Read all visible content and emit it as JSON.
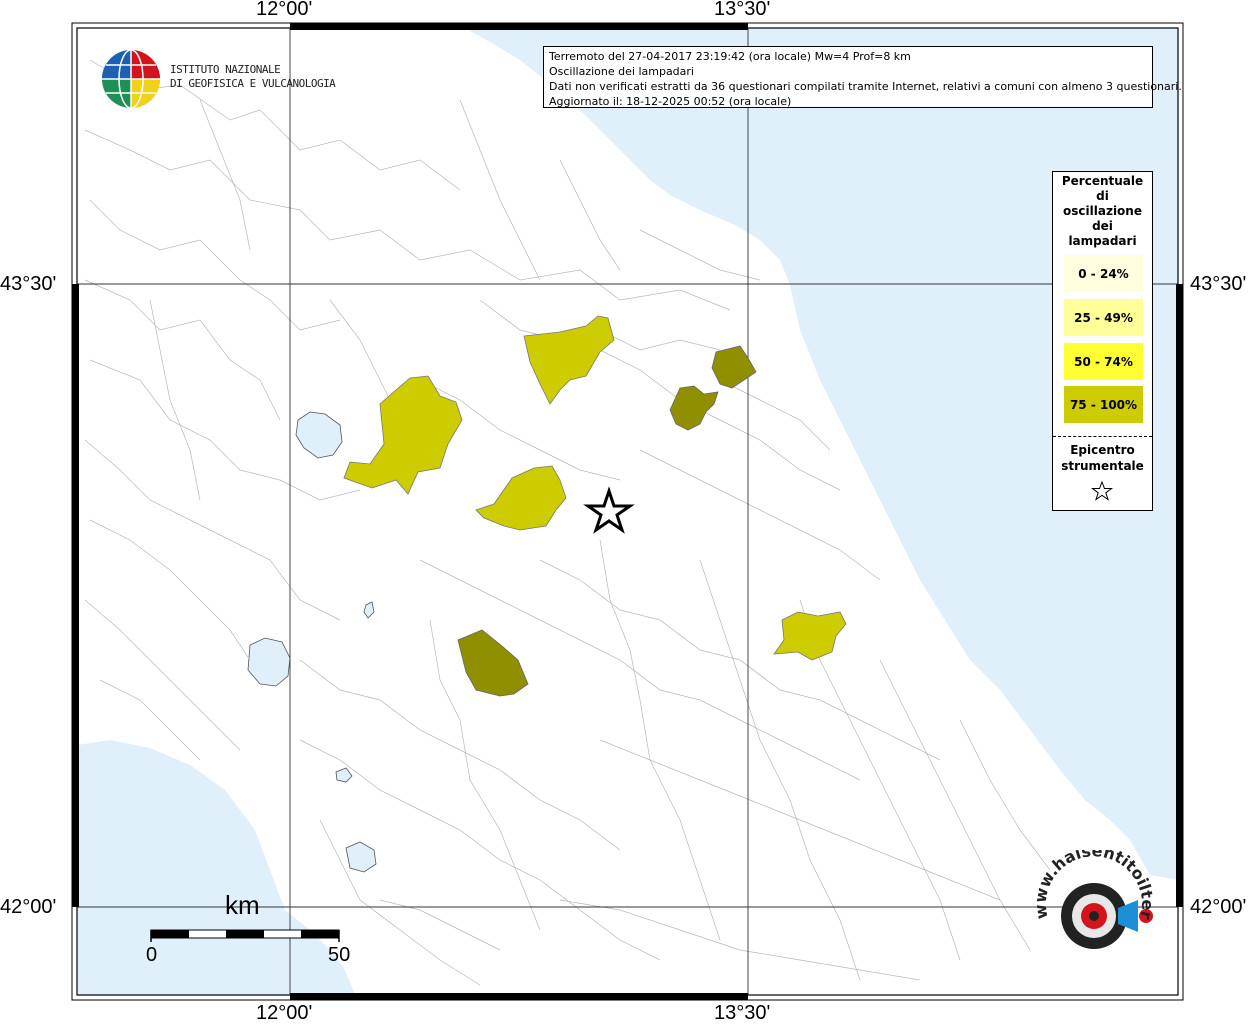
{
  "info": {
    "line1": "Terremoto del 27-04-2017 23:19:42 (ora locale) Mw=4 Prof=8 km",
    "line2": "Oscillazione dei lampadari",
    "line3": "Dati non verificati estratti da 36 questionari compilati tramite Internet, relativi a comuni con almeno 3 questionari.",
    "line4": "Aggiornato il: 18-12-2025 00:52 (ora locale)"
  },
  "axes": {
    "top_left": "12°00'",
    "top_right": "13°30'",
    "bottom_left": "12°00'",
    "bottom_right": "13°30'",
    "left_upper": "43°30'",
    "left_lower": "42°00'",
    "right_upper": "43°30'",
    "right_lower": "42°00'"
  },
  "legend": {
    "title_lines": [
      "Percentuale",
      "di",
      "oscillazione",
      "dei",
      "lampadari"
    ],
    "classes": [
      {
        "label": "0 - 24%",
        "color": "#ffffe0"
      },
      {
        "label": "25 - 49%",
        "color": "#ffff99"
      },
      {
        "label": "50 - 74%",
        "color": "#ffff33"
      },
      {
        "label": "75 - 100%",
        "color": "#cccc00"
      }
    ],
    "epicenter_lines": [
      "Epicentro",
      "strumentale"
    ]
  },
  "logo": {
    "line1": "ISTITUTO NAZIONALE",
    "line2": "DI GEOFISICA E VULCANOLOGIA",
    "brand": "www.haisentitoilterremoto.it"
  },
  "scalebar": {
    "unit": "km",
    "start": "0",
    "end": "50"
  },
  "colors": {
    "sea": "#dff0fb",
    "land": "#ffffff",
    "class_75_100": "#cccc00",
    "class_dark": "#8f8f00",
    "boundary": "#b0b0b0"
  }
}
